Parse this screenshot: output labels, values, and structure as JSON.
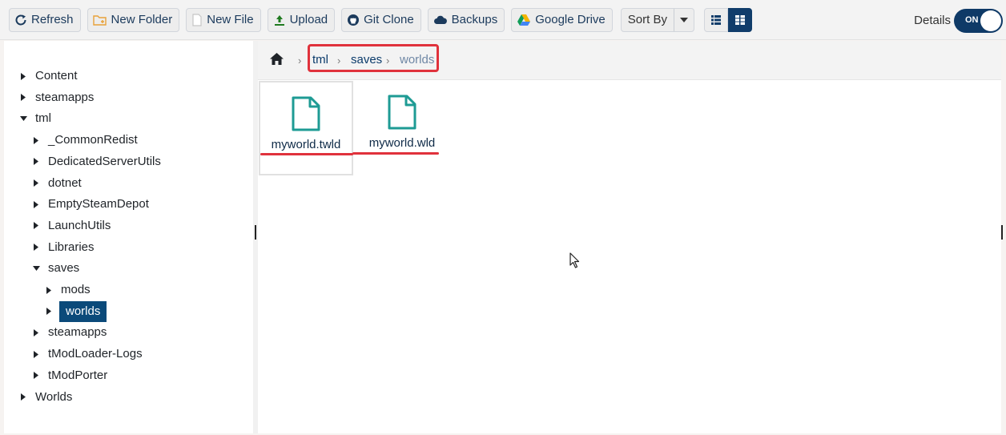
{
  "toolbar": {
    "buttons": [
      {
        "id": "refresh",
        "label": "Refresh",
        "icon": "refresh-icon"
      },
      {
        "id": "new-folder",
        "label": "New Folder",
        "icon": "new-folder-icon"
      },
      {
        "id": "new-file",
        "label": "New File",
        "icon": "new-file-icon"
      },
      {
        "id": "upload",
        "label": "Upload",
        "icon": "upload-icon"
      },
      {
        "id": "git-clone",
        "label": "Git Clone",
        "icon": "github-icon"
      },
      {
        "id": "backups",
        "label": "Backups",
        "icon": "cloud-icon"
      },
      {
        "id": "google-drive",
        "label": "Google Drive",
        "icon": "google-drive-icon"
      }
    ],
    "sort_by_label": "Sort By",
    "details_label": "Details",
    "toggle_label": "ON"
  },
  "tree": {
    "items": [
      {
        "label": "Content",
        "level": 0,
        "expanded": false
      },
      {
        "label": "steamapps",
        "level": 0,
        "expanded": false
      },
      {
        "label": "tml",
        "level": 0,
        "expanded": true
      },
      {
        "label": "_CommonRedist",
        "level": 1,
        "expanded": false
      },
      {
        "label": "DedicatedServerUtils",
        "level": 1,
        "expanded": false
      },
      {
        "label": "dotnet",
        "level": 1,
        "expanded": false
      },
      {
        "label": "EmptySteamDepot",
        "level": 1,
        "expanded": false
      },
      {
        "label": "LaunchUtils",
        "level": 1,
        "expanded": false
      },
      {
        "label": "Libraries",
        "level": 1,
        "expanded": false
      },
      {
        "label": "saves",
        "level": 1,
        "expanded": true
      },
      {
        "label": "mods",
        "level": 2,
        "expanded": false
      },
      {
        "label": "worlds",
        "level": 2,
        "expanded": false,
        "selected": true
      },
      {
        "label": "steamapps",
        "level": 1,
        "expanded": false
      },
      {
        "label": "tModLoader-Logs",
        "level": 1,
        "expanded": false
      },
      {
        "label": "tModPorter",
        "level": 1,
        "expanded": false
      },
      {
        "label": "Worlds",
        "level": 0,
        "expanded": false
      }
    ]
  },
  "breadcrumb": {
    "items": [
      "tml",
      "saves",
      "worlds"
    ]
  },
  "files": [
    {
      "name": "myworld.twld",
      "icon": "file-icon",
      "selected": true
    },
    {
      "name": "myworld.wld",
      "icon": "file-icon",
      "selected": false
    }
  ],
  "colors": {
    "accent": "#0f3a67",
    "highlight": "#e0323c",
    "file_icon": "#1e9b94"
  }
}
